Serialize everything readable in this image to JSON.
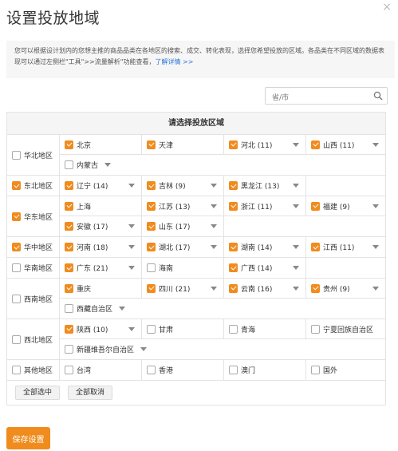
{
  "header": {
    "title": "设置投放地域",
    "close": "×"
  },
  "notice": {
    "text": "您可以根据设计划内的您想主推的商品品类在各地区的搜索、成交、转化表现，选择您希望投放的区域。各品类在不同区域的数据表现可以通过左侧栏\"工具\">>流量解析\"功能查看，",
    "link": "了解详情 >>"
  },
  "search": {
    "placeholder": "省/市"
  },
  "table": {
    "title": "请选择投放区域",
    "regions": [
      {
        "name": "华北地区",
        "checked": false,
        "lines": [
          [
            {
              "name": "北京",
              "checked": true,
              "arrow": false
            },
            {
              "name": "天津",
              "checked": true,
              "arrow": false
            },
            {
              "name": "河北 (11)",
              "checked": true,
              "arrow": true
            },
            {
              "name": "山西 (11)",
              "checked": true,
              "arrow": true
            }
          ],
          [
            {
              "name": "内蒙古",
              "checked": false,
              "arrow": true,
              "wide": true
            }
          ]
        ]
      },
      {
        "name": "东北地区",
        "checked": true,
        "lines": [
          [
            {
              "name": "辽宁 (14)",
              "checked": true,
              "arrow": true
            },
            {
              "name": "吉林 (9)",
              "checked": true,
              "arrow": true
            },
            {
              "name": "黑龙江 (13)",
              "checked": true,
              "arrow": true
            },
            {
              "blank": true
            }
          ]
        ]
      },
      {
        "name": "华东地区",
        "checked": true,
        "lines": [
          [
            {
              "name": "上海",
              "checked": true,
              "arrow": false
            },
            {
              "name": "江苏 (13)",
              "checked": true,
              "arrow": true
            },
            {
              "name": "浙江 (11)",
              "checked": true,
              "arrow": true
            },
            {
              "name": "福建 (9)",
              "checked": true,
              "arrow": true
            }
          ],
          [
            {
              "name": "安徽 (17)",
              "checked": true,
              "arrow": true
            },
            {
              "name": "山东 (17)",
              "checked": true,
              "arrow": true
            },
            {
              "blank": true
            },
            {
              "blank": true
            }
          ]
        ]
      },
      {
        "name": "华中地区",
        "checked": true,
        "lines": [
          [
            {
              "name": "河南 (18)",
              "checked": true,
              "arrow": true
            },
            {
              "name": "湖北 (17)",
              "checked": true,
              "arrow": true
            },
            {
              "name": "湖南 (14)",
              "checked": true,
              "arrow": true
            },
            {
              "name": "江西 (11)",
              "checked": true,
              "arrow": true
            }
          ]
        ]
      },
      {
        "name": "华南地区",
        "checked": false,
        "lines": [
          [
            {
              "name": "广东 (21)",
              "checked": true,
              "arrow": true
            },
            {
              "name": "海南",
              "checked": false,
              "arrow": false
            },
            {
              "name": "广西 (14)",
              "checked": true,
              "arrow": true
            },
            {
              "blank": true
            }
          ]
        ]
      },
      {
        "name": "西南地区",
        "checked": false,
        "lines": [
          [
            {
              "name": "重庆",
              "checked": true,
              "arrow": false
            },
            {
              "name": "四川 (21)",
              "checked": true,
              "arrow": true
            },
            {
              "name": "云南 (16)",
              "checked": true,
              "arrow": true
            },
            {
              "name": "贵州 (9)",
              "checked": true,
              "arrow": true
            }
          ],
          [
            {
              "name": "西藏自治区",
              "checked": false,
              "arrow": true,
              "wide": true
            }
          ]
        ]
      },
      {
        "name": "西北地区",
        "checked": false,
        "lines": [
          [
            {
              "name": "陕西 (10)",
              "checked": true,
              "arrow": true
            },
            {
              "name": "甘肃",
              "checked": false,
              "arrow": false
            },
            {
              "name": "青海",
              "checked": false,
              "arrow": false
            },
            {
              "name": "宁夏回族自治区",
              "checked": false,
              "arrow": false
            }
          ],
          [
            {
              "name": "新疆维吾尔自治区",
              "checked": false,
              "arrow": true,
              "wide": true
            }
          ]
        ]
      },
      {
        "name": "其他地区",
        "checked": false,
        "lines": [
          [
            {
              "name": "台湾",
              "checked": false,
              "arrow": false
            },
            {
              "name": "香港",
              "checked": false,
              "arrow": false
            },
            {
              "name": "澳门",
              "checked": false,
              "arrow": false
            },
            {
              "name": "国外",
              "checked": false,
              "arrow": false
            }
          ]
        ]
      }
    ],
    "select_all": "全部选中",
    "deselect_all": "全部取消"
  },
  "save_label": "保存设置",
  "colors": {
    "accent": "#f08c1e",
    "link": "#2a74d8"
  }
}
